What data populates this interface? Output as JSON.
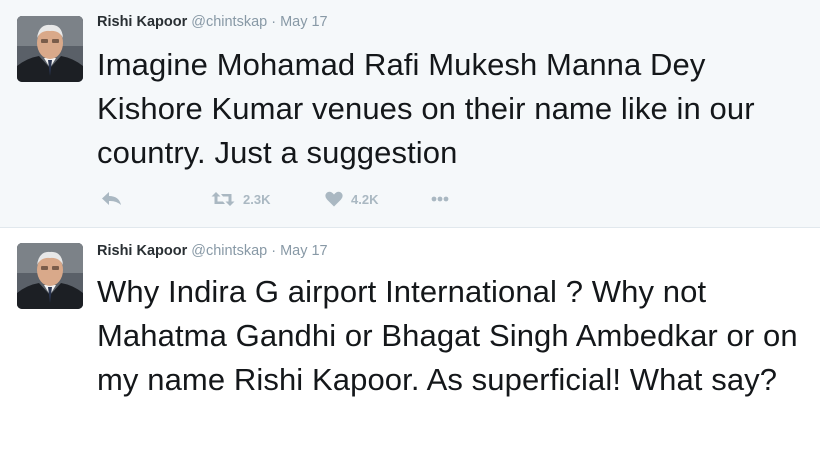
{
  "tweets": [
    {
      "name": "Rishi Kapoor",
      "handle": "@chintskap",
      "separator": "·",
      "date": "May 17",
      "text": "Imagine Mohamad Rafi Mukesh Manna Dey Kishore Kumar venues on their name like in our country. Just a suggestion",
      "retweets": "2.3K",
      "likes": "4.2K",
      "icons": [
        "reply-icon",
        "retweet-icon",
        "heart-icon",
        "more-icon"
      ]
    },
    {
      "name": "Rishi Kapoor",
      "handle": "@chintskap",
      "separator": "·",
      "date": "May 17",
      "text": "Why Indira G airport International ? Why not Mahatma Gandhi or Bhagat Singh Ambedkar or on my name Rishi Kapoor. As superficial! What say?"
    }
  ],
  "colors": {
    "muted": "#8899a6",
    "action_icon": "#aab8c2",
    "tweet_bg_highlight": "#f5f8fa",
    "text": "#14171a"
  }
}
